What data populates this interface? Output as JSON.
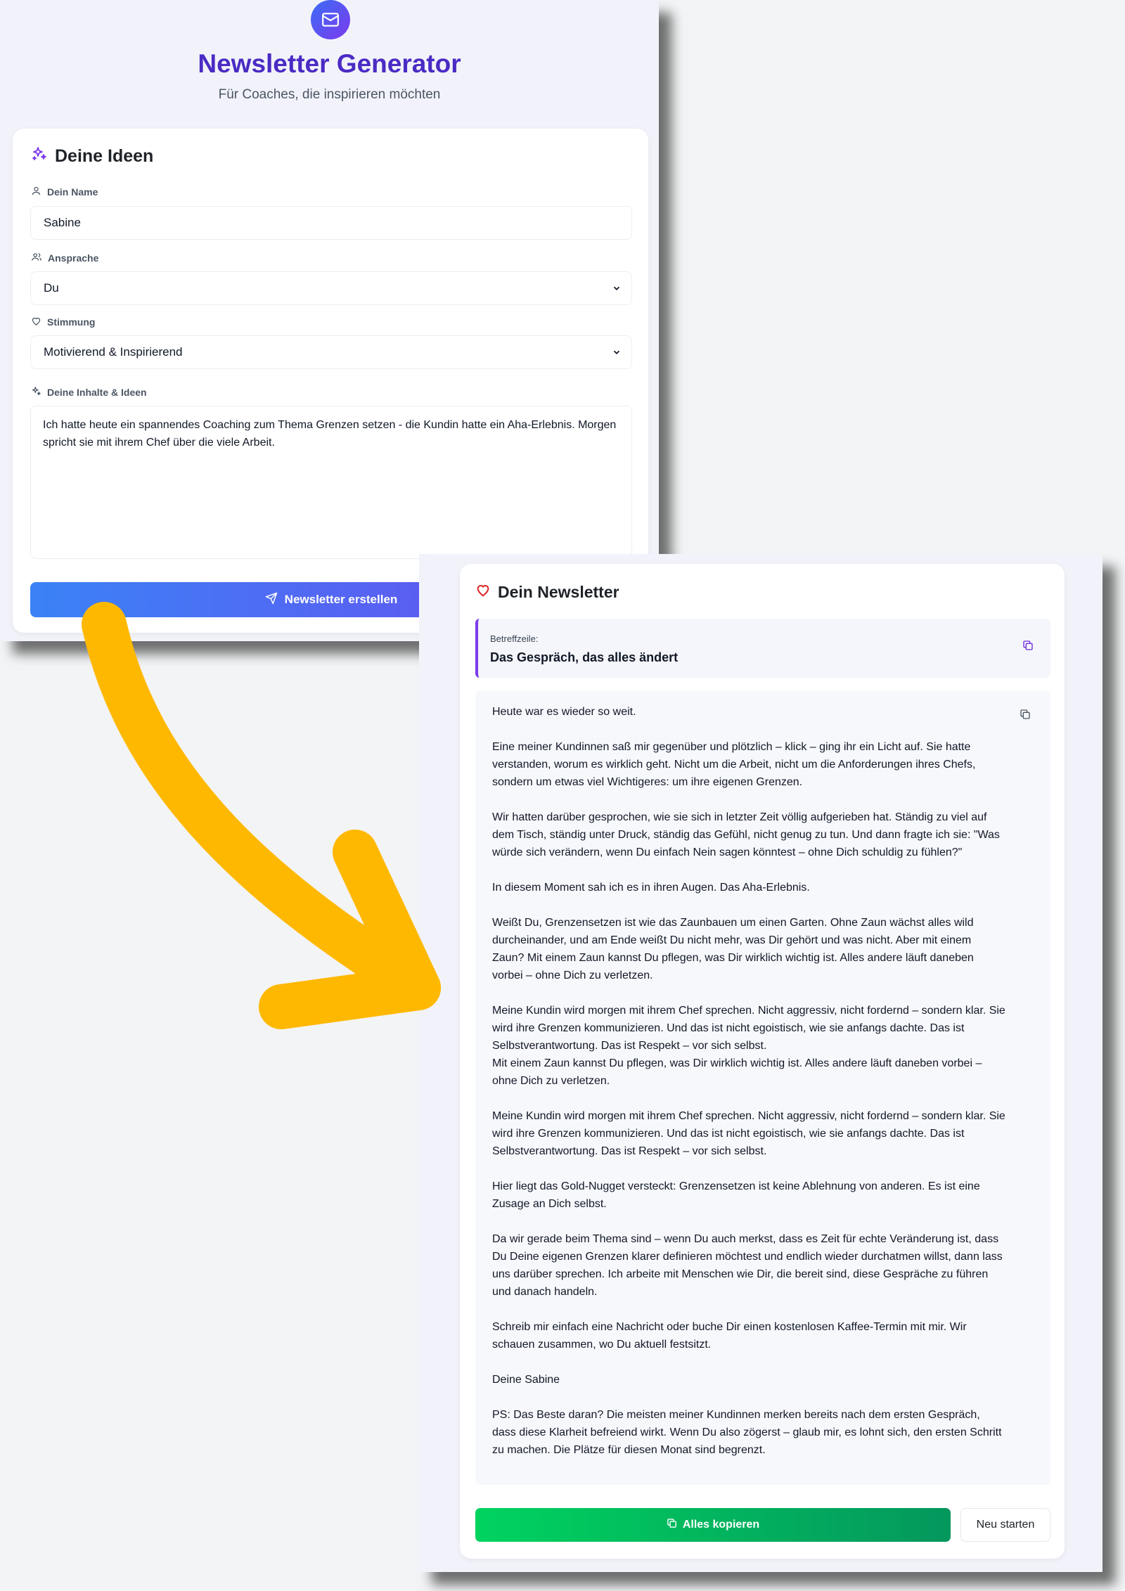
{
  "generator": {
    "title": "Newsletter Generator",
    "subtitle": "Für Coaches, die inspirieren möchten",
    "form": {
      "heading": "Deine Ideen",
      "name_label": "Dein Name",
      "name_value": "Sabine",
      "address_label": "Ansprache",
      "address_value": "Du",
      "mood_label": "Stimmung",
      "mood_value": "Motivierend & Inspirierend",
      "content_label": "Deine Inhalte & Ideen",
      "content_value": "Ich hatte heute ein spannendes Coaching zum Thema Grenzen setzen - die Kundin hatte ein Aha-Erlebnis. Morgen spricht sie mit ihrem Chef über die viele Arbeit.",
      "submit_label": "Newsletter erstellen"
    }
  },
  "result": {
    "heading": "Dein Newsletter",
    "subject_label": "Betreffzeile:",
    "subject_value": "Das Gespräch, das alles ändert",
    "paragraphs": [
      "Heute war es wieder so weit.",
      "Eine meiner Kundinnen saß mir gegenüber und plötzlich – klick – ging ihr ein Licht auf. Sie hatte verstanden, worum es wirklich geht. Nicht um die Arbeit, nicht um die Anforderungen ihres Chefs, sondern um etwas viel Wichtigeres: um ihre eigenen Grenzen.",
      "Wir hatten darüber gesprochen, wie sie sich in letzter Zeit völlig aufgerieben hat. Ständig zu viel auf dem Tisch, ständig unter Druck, ständig das Gefühl, nicht genug zu tun. Und dann fragte ich sie: \"Was würde sich verändern, wenn Du einfach Nein sagen könntest – ohne Dich schuldig zu fühlen?\"",
      "In diesem Moment sah ich es in ihren Augen. Das Aha-Erlebnis.",
      "Weißt Du, Grenzensetzen ist wie das Zaunbauen um einen Garten. Ohne Zaun wächst alles wild durcheinander, und am Ende weißt Du nicht mehr, was Dir gehört und was nicht. Aber mit einem Zaun? Mit einem Zaun kannst Du pflegen, was Dir wirklich wichtig ist. Alles andere läuft daneben vorbei – ohne Dich zu verletzen.",
      "Meine Kundin wird morgen mit ihrem Chef sprechen. Nicht aggressiv, nicht fordernd – sondern klar. Sie wird ihre Grenzen kommunizieren. Und das ist nicht egoistisch, wie sie anfangs dachte. Das ist Selbstverantwortung. Das ist Respekt – vor sich selbst.",
      "Mit einem Zaun kannst Du pflegen, was Dir wirklich wichtig ist. Alles andere läuft daneben vorbei – ohne Dich zu verletzen.",
      "Meine Kundin wird morgen mit ihrem Chef sprechen. Nicht aggressiv, nicht fordernd – sondern klar. Sie wird ihre Grenzen kommunizieren. Und das ist nicht egoistisch, wie sie anfangs dachte. Das ist Selbstverantwortung. Das ist Respekt – vor sich selbst.",
      "Hier liegt das Gold-Nugget versteckt: Grenzensetzen ist keine Ablehnung von anderen. Es ist eine Zusage an Dich selbst.",
      "Da wir gerade beim Thema sind – wenn Du auch merkst, dass es Zeit für echte Veränderung ist, dass Du Deine eigenen Grenzen klarer definieren möchtest und endlich wieder durchatmen willst, dann lass uns darüber sprechen. Ich arbeite mit Menschen wie Dir, die bereit sind, diese Gespräche zu führen und danach handeln.",
      "Schreib mir einfach eine Nachricht oder buche Dir einen kostenlosen Kaffee-Termin mit mir. Wir schauen zusammen, wo Du aktuell festsitzt.",
      "Deine Sabine",
      "PS: Das Beste daran? Die meisten meiner Kundinnen merken bereits nach dem ersten Gespräch, dass diese Klarheit befreiend wirkt. Wenn Du also zögerst – glaub mir, es lohnt sich, den ersten Schritt zu machen. Die Plätze für diesen Monat sind begrenzt."
    ],
    "copy_all_label": "Alles kopieren",
    "restart_label": "Neu starten"
  },
  "colors": {
    "brand_purple": "#4a2bc4",
    "accent_violet": "#7c3aed",
    "button_blue": "#3b82f6",
    "success_green": "#00c853",
    "arrow_yellow": "#ffb800",
    "heart_red": "#dc2626"
  },
  "icons": [
    "mail-icon",
    "sparkles-icon",
    "user-icon",
    "users-icon",
    "heart-icon",
    "send-icon",
    "copy-icon",
    "chevron-down-icon"
  ]
}
